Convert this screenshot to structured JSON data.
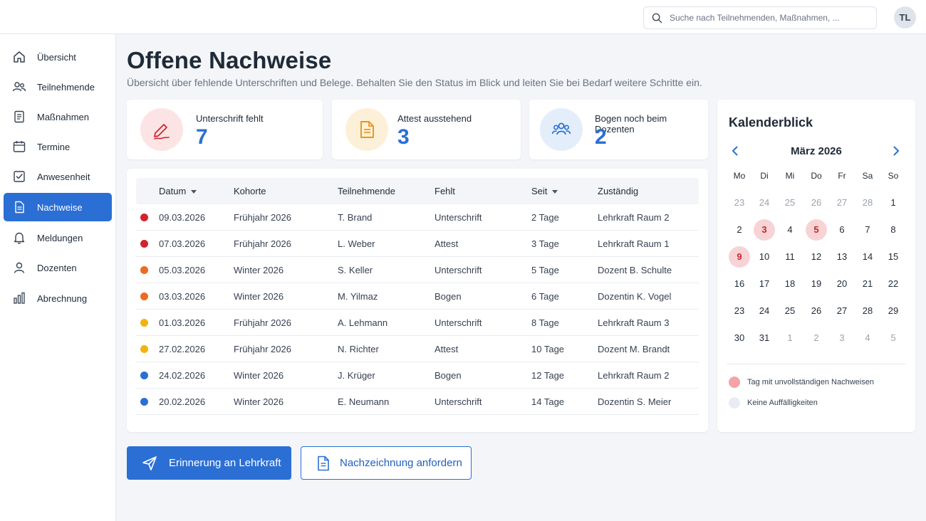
{
  "header": {
    "search_placeholder": "Suche nach Teilnehmenden, Maßnahmen, ...",
    "avatar_initials": "TL"
  },
  "sidebar": {
    "items": [
      {
        "label": "Übersicht",
        "icon": "home-icon"
      },
      {
        "label": "Teilnehmende",
        "icon": "users-icon"
      },
      {
        "label": "Maßnahmen",
        "icon": "clipboard-icon"
      },
      {
        "label": "Termine",
        "icon": "calendar-icon"
      },
      {
        "label": "Anwesenheit",
        "icon": "checkbox-icon"
      },
      {
        "label": "Nachweise",
        "icon": "document-icon",
        "active": true
      },
      {
        "label": "Meldungen",
        "icon": "bell-icon"
      },
      {
        "label": "Dozenten",
        "icon": "user-icon"
      },
      {
        "label": "Abrechnung",
        "icon": "bar-chart-icon"
      }
    ]
  },
  "page": {
    "title": "Offene Nachweise",
    "subtitle": "Übersicht über fehlende Unterschriften und Belege. Behalten Sie den Status im Blick und leiten Sie bei Bedarf weitere Schritte ein."
  },
  "stats": [
    {
      "label": "Unterschrift fehlt",
      "value": "7",
      "icon": "signature-icon"
    },
    {
      "label": "Attest ausstehend",
      "value": "3",
      "icon": "document-icon"
    },
    {
      "label": "Bogen noch beim Dozenten",
      "value": "2",
      "icon": "group-icon"
    }
  ],
  "table": {
    "headers": {
      "datum": "Datum",
      "kohorte": "Kohorte",
      "teilnehmende": "Teilnehmende",
      "fehlt": "Fehlt",
      "seit": "Seit",
      "zustaendig": "Zuständig"
    },
    "rows": [
      {
        "status": "#d0232f",
        "datum": "09.03.2026",
        "kohorte": "Frühjahr 2026",
        "teilnehmende": "T. Brand",
        "fehlt": "Unterschrift",
        "seit": "2 Tage",
        "zustaendig": "Lehrkraft Raum 2"
      },
      {
        "status": "#d0232f",
        "datum": "07.03.2026",
        "kohorte": "Frühjahr 2026",
        "teilnehmende": "L. Weber",
        "fehlt": "Attest",
        "seit": "3 Tage",
        "zustaendig": "Lehrkraft Raum 1"
      },
      {
        "status": "#ee6a1f",
        "datum": "05.03.2026",
        "kohorte": "Winter 2026",
        "teilnehmende": "S. Keller",
        "fehlt": "Unterschrift",
        "seit": "5 Tage",
        "zustaendig": "Dozent B. Schulte"
      },
      {
        "status": "#ee6a1f",
        "datum": "03.03.2026",
        "kohorte": "Winter 2026",
        "teilnehmende": "M. Yilmaz",
        "fehlt": "Bogen",
        "seit": "6 Tage",
        "zustaendig": "Dozentin K. Vogel"
      },
      {
        "status": "#f2b311",
        "datum": "01.03.2026",
        "kohorte": "Frühjahr 2026",
        "teilnehmende": "A. Lehmann",
        "fehlt": "Unterschrift",
        "seit": "8 Tage",
        "zustaendig": "Lehrkraft Raum 3"
      },
      {
        "status": "#f2b311",
        "datum": "27.02.2026",
        "kohorte": "Frühjahr 2026",
        "teilnehmende": "N. Richter",
        "fehlt": "Attest",
        "seit": "10 Tage",
        "zustaendig": "Dozent M. Brandt"
      },
      {
        "status": "#2b6fd4",
        "datum": "24.02.2026",
        "kohorte": "Winter 2026",
        "teilnehmende": "J. Krüger",
        "fehlt": "Bogen",
        "seit": "12 Tage",
        "zustaendig": "Lehrkraft Raum 2"
      },
      {
        "status": "#2b6fd4",
        "datum": "20.02.2026",
        "kohorte": "Winter 2026",
        "teilnehmende": "E. Neumann",
        "fehlt": "Unterschrift",
        "seit": "14 Tage",
        "zustaendig": "Dozentin S. Meier"
      }
    ]
  },
  "calendar": {
    "title": "Kalenderblick",
    "month": "März 2026",
    "weekdays": [
      "Mo",
      "Di",
      "Mi",
      "Do",
      "Fr",
      "Sa",
      "So"
    ],
    "weeks": [
      [
        {
          "d": "23",
          "m": true
        },
        {
          "d": "24",
          "m": true
        },
        {
          "d": "25",
          "m": true
        },
        {
          "d": "26",
          "m": true
        },
        {
          "d": "27",
          "m": true
        },
        {
          "d": "28",
          "m": true
        },
        {
          "d": "1"
        }
      ],
      [
        {
          "d": "2"
        },
        {
          "d": "3",
          "h": true
        },
        {
          "d": "4"
        },
        {
          "d": "5",
          "h": true
        },
        {
          "d": "6"
        },
        {
          "d": "7"
        },
        {
          "d": "8"
        }
      ],
      [
        {
          "d": "9",
          "h": true
        },
        {
          "d": "10"
        },
        {
          "d": "11"
        },
        {
          "d": "12"
        },
        {
          "d": "13"
        },
        {
          "d": "14"
        },
        {
          "d": "15"
        }
      ],
      [
        {
          "d": "16"
        },
        {
          "d": "17"
        },
        {
          "d": "18"
        },
        {
          "d": "19"
        },
        {
          "d": "20"
        },
        {
          "d": "21"
        },
        {
          "d": "22"
        }
      ],
      [
        {
          "d": "23"
        },
        {
          "d": "24"
        },
        {
          "d": "25"
        },
        {
          "d": "26"
        },
        {
          "d": "27"
        },
        {
          "d": "28"
        },
        {
          "d": "29"
        }
      ],
      [
        {
          "d": "30"
        },
        {
          "d": "31"
        },
        {
          "d": "1",
          "m": true
        },
        {
          "d": "2",
          "m": true
        },
        {
          "d": "3",
          "m": true
        },
        {
          "d": "4",
          "m": true
        },
        {
          "d": "5",
          "m": true
        }
      ]
    ],
    "legend": [
      {
        "label": "Tag mit unvollständigen Nachweisen",
        "color": "#f4a3a8"
      },
      {
        "label": "Keine Auffälligkeiten",
        "color": "#e9ecf1"
      }
    ]
  },
  "actions": {
    "primary_label": "Erinnerung an Lehrkraft",
    "secondary_label": "Nachzeichnung anfordern"
  },
  "colors": {
    "accent": "#2b6fd4",
    "danger": "#d0232f",
    "warning": "#ee6a1f",
    "caution": "#f2b311"
  }
}
